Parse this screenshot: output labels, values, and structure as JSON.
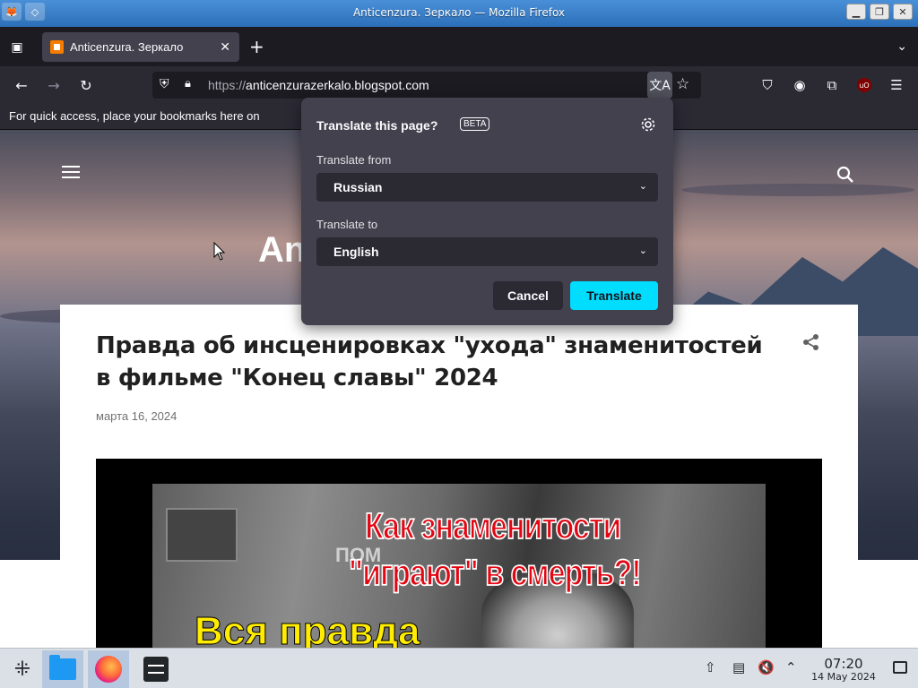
{
  "window": {
    "title": "Anticenzura. Зеркало — Mozilla Firefox",
    "min_glyph": "▁",
    "max_glyph": "❐",
    "close_glyph": "✕"
  },
  "tabs": [
    {
      "label": "Anticenzura. Зеркало",
      "close_glyph": "✕"
    }
  ],
  "tabstrip": {
    "new_tab_glyph": "+",
    "list_all_glyph": "⌄",
    "firefox_view_glyph": "▣"
  },
  "navbar": {
    "back_glyph": "←",
    "forward_glyph": "→",
    "reload_glyph": "↻",
    "url_scheme": "https://",
    "url_host": "anticenzurazerkalo.blogspot.com",
    "translate_glyph": "文A",
    "bookmark_glyph": "☆",
    "ublock_label": "uO",
    "menu_glyph": "☰",
    "pocket_glyph": "⛉",
    "account_glyph": "◉",
    "extensions_glyph": "⧉"
  },
  "bookmarks": {
    "hint": "For quick access, place your bookmarks here on"
  },
  "blog": {
    "title_visible": "An",
    "post": {
      "title": "Правда об инсценировках \"ухода\" знаменитостей в фильме \"Конец славы\" 2024",
      "date": "марта 16, 2024",
      "image_text_1": "Как знаменитости",
      "image_text_2": "\"играют\" в смерть?!",
      "image_text_3": "Вся правда",
      "image_text_pom": "ПОМ"
    }
  },
  "translate_popup": {
    "title": "Translate this page?",
    "beta": "BETA",
    "from_label": "Translate from",
    "from_value": "Russian",
    "to_label": "Translate to",
    "to_value": "English",
    "chevron": "⌄",
    "cancel": "Cancel",
    "translate": "Translate",
    "accent_color": "#00ddff"
  },
  "taskbar": {
    "time": "07:20",
    "date": "14 May 2024",
    "launcher_glyph": "⁜",
    "tray_icons": [
      "update-icon",
      "clipboard-icon",
      "volume-muted-icon",
      "expand-tray-icon"
    ],
    "tray_update_glyph": "⇧",
    "tray_clipboard_glyph": "▤",
    "tray_volume_glyph": "🔇",
    "tray_expand_glyph": "⌃"
  }
}
